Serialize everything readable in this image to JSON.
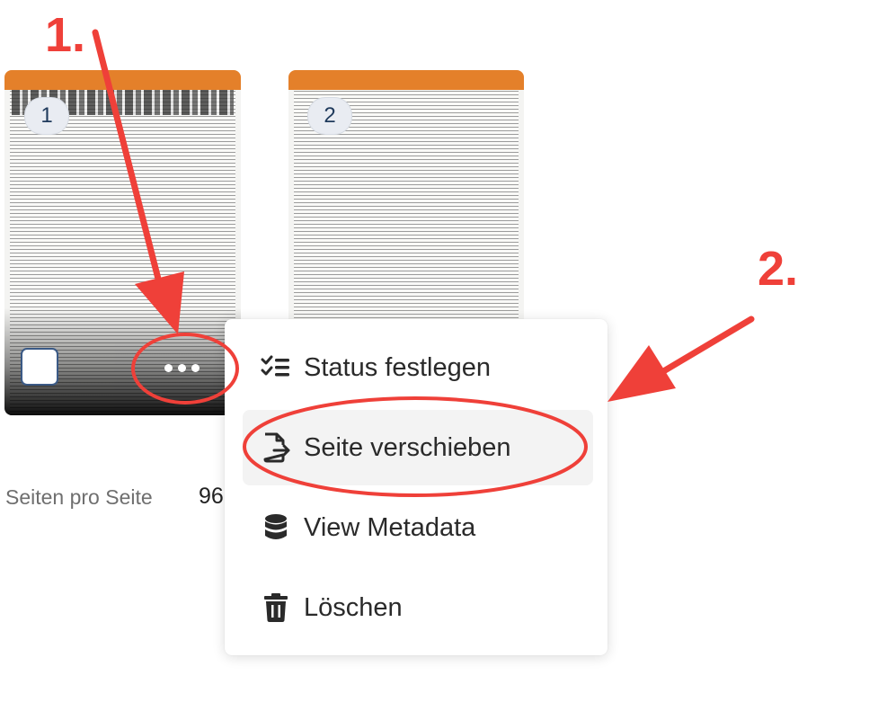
{
  "pages": [
    {
      "number": "1"
    },
    {
      "number": "2"
    }
  ],
  "footer": {
    "per_page_label": "Seiten pro Seite",
    "per_page_value": "96"
  },
  "context_menu": {
    "items": [
      {
        "label": "Status festlegen",
        "icon": "list-check-icon"
      },
      {
        "label": "Seite verschieben",
        "icon": "file-export-icon"
      },
      {
        "label": "View Metadata",
        "icon": "database-icon"
      },
      {
        "label": "Löschen",
        "icon": "trash-icon"
      }
    ]
  },
  "annotations": {
    "step1": "1.",
    "step2": "2."
  },
  "colors": {
    "thumbnail_header": "#e4802a",
    "annotation": "#ef4039"
  }
}
